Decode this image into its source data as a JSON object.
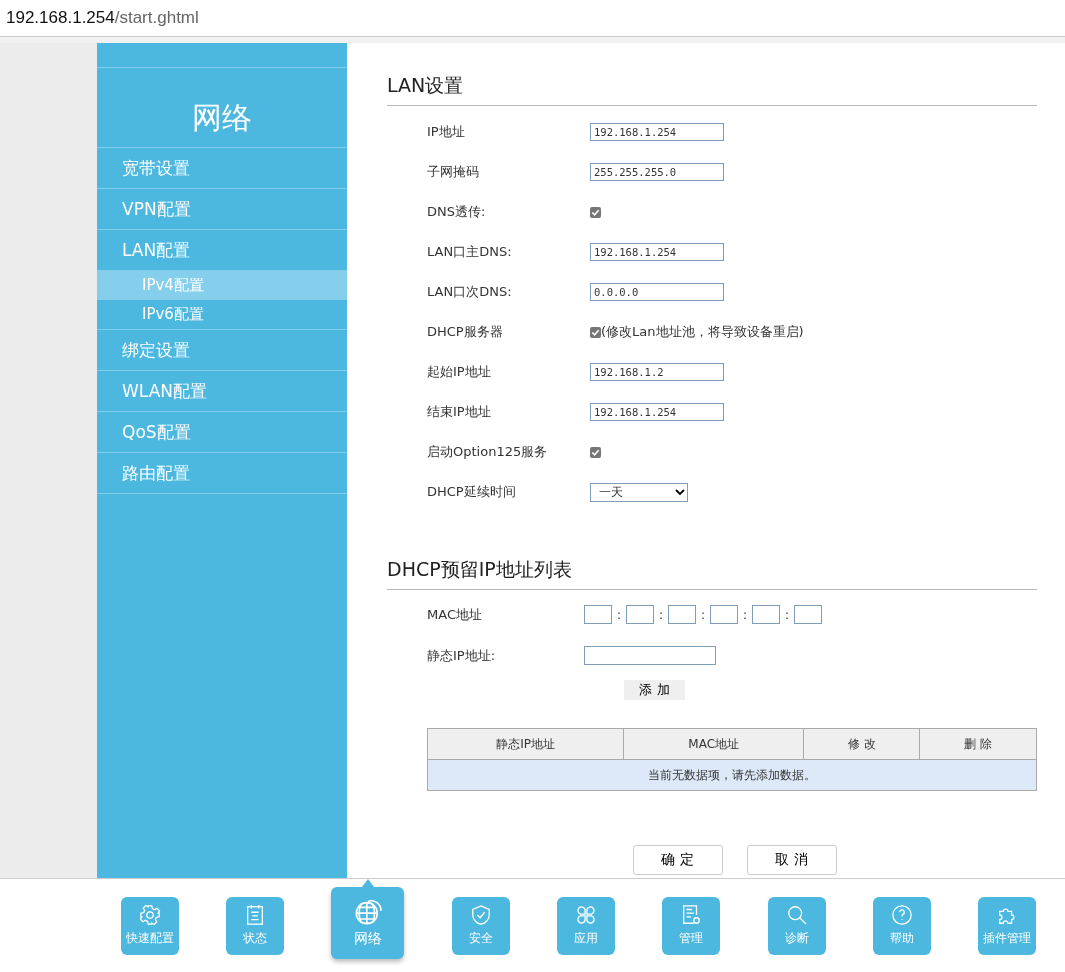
{
  "address_bar": {
    "host": "192.168.1.254",
    "path": "/start.ghtml"
  },
  "sidebar": {
    "title": "网络",
    "items": [
      {
        "label": "宽带设置",
        "selected": false
      },
      {
        "label": "VPN配置",
        "selected": false
      },
      {
        "label": "LAN配置",
        "selected": false,
        "children": [
          {
            "label": "IPv4配置",
            "selected": true
          },
          {
            "label": "IPv6配置",
            "selected": false
          }
        ]
      },
      {
        "label": "绑定设置",
        "selected": false
      },
      {
        "label": "WLAN配置",
        "selected": false
      },
      {
        "label": "QoS配置",
        "selected": false
      },
      {
        "label": "路由配置",
        "selected": false
      }
    ]
  },
  "lan_settings": {
    "title": "LAN设置",
    "rows": [
      {
        "kind": "text",
        "label": "IP地址",
        "value": "192.168.1.254"
      },
      {
        "kind": "text",
        "label": "子网掩码",
        "value": "255.255.255.0"
      },
      {
        "kind": "checkbox",
        "label": "DNS透传:",
        "checked": true
      },
      {
        "kind": "text",
        "label": "LAN口主DNS:",
        "value": "192.168.1.254"
      },
      {
        "kind": "text",
        "label": "LAN口次DNS:",
        "value": "0.0.0.0"
      },
      {
        "kind": "checkbox",
        "label": "DHCP服务器",
        "checked": true,
        "note": "(修改Lan地址池，将导致设备重启)"
      },
      {
        "kind": "text",
        "label": "起始IP地址",
        "value": "192.168.1.2"
      },
      {
        "kind": "text",
        "label": "结束IP地址",
        "value": "192.168.1.254"
      },
      {
        "kind": "checkbox",
        "label": "启动Option125服务",
        "checked": true
      },
      {
        "kind": "select",
        "label": "DHCP延续时间",
        "value": "一天"
      }
    ]
  },
  "dhcp_reservation": {
    "title": "DHCP预留IP地址列表",
    "mac_label": "MAC地址",
    "mac_separators": [
      ":",
      ":",
      ":",
      ":",
      ":"
    ],
    "ip_label": "静态IP地址:",
    "add_button": "添 加",
    "table": {
      "columns": [
        "静态IP地址",
        "MAC地址",
        "修 改",
        "删 除"
      ],
      "empty_message": "当前无数据项，请先添加数据。"
    }
  },
  "buttons": [
    "确 定",
    "取 消"
  ],
  "bottom_nav": [
    {
      "label": "快速配置",
      "selected": false
    },
    {
      "label": "状态",
      "selected": false
    },
    {
      "label": "网络",
      "selected": true
    },
    {
      "label": "安全",
      "selected": false
    },
    {
      "label": "应用",
      "selected": false
    },
    {
      "label": "管理",
      "selected": false
    },
    {
      "label": "诊断",
      "selected": false
    },
    {
      "label": "帮助",
      "selected": false
    },
    {
      "label": "插件管理",
      "selected": false
    }
  ]
}
